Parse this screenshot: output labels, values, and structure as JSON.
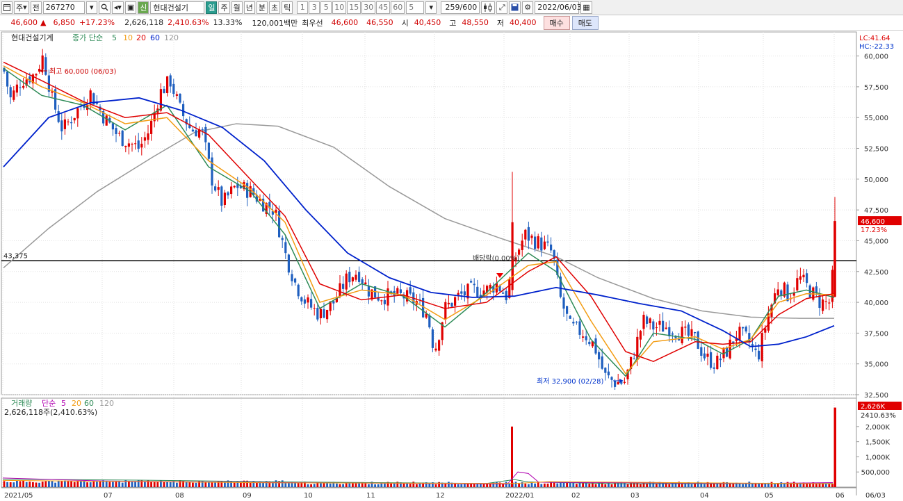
{
  "toolbar": {
    "type_label": "주",
    "prefix_label": "전",
    "code": "267270",
    "badge_label": "신",
    "name": "현대건설기",
    "periods": [
      "일",
      "주",
      "월",
      "년",
      "분",
      "초",
      "틱"
    ],
    "active_period": "일",
    "minute_options": [
      "1",
      "3",
      "5",
      "10",
      "15",
      "30",
      "45",
      "60"
    ],
    "interval_value": "5",
    "count": "259/600",
    "date": "2022/06/03"
  },
  "quote": {
    "price": "46,600",
    "arrow": "▲",
    "change": "6,850",
    "change_pct": "+17.23%",
    "volume": "2,626,118",
    "volume_pct": "2,410.63%",
    "turnover_pct": "13.33%",
    "amount": "120,001백만",
    "best_label": "최우선",
    "ask": "46,600",
    "bid": "46,550",
    "open_label": "시",
    "open": "40,450",
    "high_label": "고",
    "high": "48,550",
    "low_label": "저",
    "low": "40,400",
    "buy_label": "매수",
    "sell_label": "매도"
  },
  "chart": {
    "stock_name": "현대건설기계",
    "ma_type": "종가 단순",
    "ma_periods": [
      "5",
      "10",
      "20",
      "60",
      "120"
    ],
    "lc_label": "LC:41.64",
    "hc_label": "HC:-22.33",
    "hline_label": "43,375",
    "hline_value": 43375,
    "max_label": "최고 60,000 (06/03)",
    "min_label": "최저 32,900 (02/28)",
    "dividend_label": "배당락(0.00%)",
    "current_price": "46,600",
    "current_pct": "17.23%",
    "y_ticks": [
      "60,000",
      "57,500",
      "55,000",
      "52,500",
      "50,000",
      "47,500",
      "45,000",
      "42,500",
      "40,000",
      "37,500",
      "35,000",
      "32,500"
    ],
    "x_ticks": [
      "2021/05",
      "07",
      "08",
      "09",
      "10",
      "11",
      "12",
      "2022/01",
      "02",
      "03",
      "04",
      "05",
      "06",
      "06/03"
    ],
    "colors": {
      "ma5": "#2e8b57",
      "ma10": "#f39c12",
      "ma20": "#e00000",
      "ma60": "#0022cc",
      "ma120": "#999999",
      "up": "#e00000",
      "down": "#1f5fbf"
    }
  },
  "volume": {
    "title": "거래량",
    "ma_type": "단순",
    "ma_periods": [
      "5",
      "20",
      "60",
      "120"
    ],
    "info": "2,626,118주(2,410.63%)",
    "current": "2,626K",
    "current_pct": "2410.63%",
    "y_ticks": [
      "2,000K",
      "1,500K",
      "1,000K",
      "500,000"
    ]
  },
  "chart_data": {
    "type": "candlestick",
    "x_range": [
      "2021/05",
      "2022/06/03"
    ],
    "y_range": [
      32500,
      61500
    ],
    "close_path": [
      [
        5,
        59000
      ],
      [
        15,
        56500
      ],
      [
        30,
        58000
      ],
      [
        50,
        58500
      ],
      [
        62,
        60000
      ],
      [
        75,
        56500
      ],
      [
        90,
        54000
      ],
      [
        110,
        55500
      ],
      [
        130,
        57000
      ],
      [
        150,
        55000
      ],
      [
        170,
        53500
      ],
      [
        185,
        53000
      ],
      [
        200,
        52500
      ],
      [
        215,
        54000
      ],
      [
        230,
        57000
      ],
      [
        245,
        58000
      ],
      [
        260,
        55500
      ],
      [
        275,
        54000
      ],
      [
        290,
        54000
      ],
      [
        305,
        50000
      ],
      [
        320,
        48000
      ],
      [
        340,
        49500
      ],
      [
        360,
        49000
      ],
      [
        380,
        48000
      ],
      [
        395,
        47500
      ],
      [
        410,
        44000
      ],
      [
        425,
        41500
      ],
      [
        440,
        40000
      ],
      [
        460,
        39000
      ],
      [
        480,
        40000
      ],
      [
        500,
        42000
      ],
      [
        515,
        42500
      ],
      [
        530,
        41000
      ],
      [
        545,
        40500
      ],
      [
        560,
        40500
      ],
      [
        580,
        40500
      ],
      [
        600,
        40000
      ],
      [
        615,
        39000
      ],
      [
        625,
        36000
      ],
      [
        640,
        39500
      ],
      [
        660,
        40500
      ],
      [
        680,
        41000
      ],
      [
        700,
        41000
      ],
      [
        715,
        41500
      ],
      [
        728,
        40500
      ],
      [
        740,
        43500
      ],
      [
        755,
        45500
      ],
      [
        770,
        45000
      ],
      [
        785,
        44500
      ],
      [
        795,
        44000
      ],
      [
        805,
        40500
      ],
      [
        820,
        38000
      ],
      [
        840,
        37500
      ],
      [
        855,
        36500
      ],
      [
        870,
        34000
      ],
      [
        885,
        33500
      ],
      [
        898,
        33500
      ],
      [
        910,
        35500
      ],
      [
        925,
        38500
      ],
      [
        940,
        38000
      ],
      [
        960,
        38000
      ],
      [
        980,
        37500
      ],
      [
        1000,
        37000
      ],
      [
        1015,
        35500
      ],
      [
        1030,
        35000
      ],
      [
        1045,
        36000
      ],
      [
        1060,
        37500
      ],
      [
        1075,
        37000
      ],
      [
        1090,
        35500
      ],
      [
        1105,
        39000
      ],
      [
        1120,
        41500
      ],
      [
        1135,
        40500
      ],
      [
        1150,
        42000
      ],
      [
        1165,
        41000
      ],
      [
        1180,
        40000
      ],
      [
        1195,
        40000
      ],
      [
        1203,
        46600
      ]
    ],
    "ma_series": [
      {
        "name": "5",
        "points": [
          [
            5,
            59000
          ],
          [
            60,
            56800
          ],
          [
            120,
            56000
          ],
          [
            180,
            54000
          ],
          [
            240,
            56000
          ],
          [
            300,
            51000
          ],
          [
            360,
            49000
          ],
          [
            410,
            45500
          ],
          [
            460,
            39500
          ],
          [
            520,
            41500
          ],
          [
            580,
            40500
          ],
          [
            640,
            38000
          ],
          [
            700,
            40800
          ],
          [
            760,
            44000
          ],
          [
            800,
            42500
          ],
          [
            850,
            37000
          ],
          [
            900,
            34000
          ],
          [
            940,
            37500
          ],
          [
            1000,
            37000
          ],
          [
            1040,
            35800
          ],
          [
            1080,
            37000
          ],
          [
            1120,
            40500
          ],
          [
            1160,
            41000
          ],
          [
            1200,
            40400
          ]
        ]
      },
      {
        "name": "10",
        "points": [
          [
            5,
            59200
          ],
          [
            60,
            57500
          ],
          [
            120,
            56200
          ],
          [
            180,
            54500
          ],
          [
            240,
            55000
          ],
          [
            300,
            51500
          ],
          [
            360,
            49200
          ],
          [
            410,
            46500
          ],
          [
            460,
            40000
          ],
          [
            520,
            41000
          ],
          [
            580,
            40600
          ],
          [
            640,
            38600
          ],
          [
            700,
            40600
          ],
          [
            760,
            43000
          ],
          [
            800,
            43300
          ],
          [
            850,
            38500
          ],
          [
            900,
            34200
          ],
          [
            940,
            36800
          ],
          [
            1000,
            37200
          ],
          [
            1040,
            36200
          ],
          [
            1080,
            37000
          ],
          [
            1120,
            40000
          ],
          [
            1160,
            40700
          ],
          [
            1200,
            40600
          ]
        ]
      },
      {
        "name": "20",
        "points": [
          [
            5,
            59500
          ],
          [
            60,
            58000
          ],
          [
            120,
            56300
          ],
          [
            180,
            55000
          ],
          [
            240,
            55400
          ],
          [
            300,
            53600
          ],
          [
            360,
            50000
          ],
          [
            410,
            47000
          ],
          [
            460,
            41500
          ],
          [
            520,
            40200
          ],
          [
            580,
            40600
          ],
          [
            640,
            39500
          ],
          [
            700,
            40000
          ],
          [
            760,
            42500
          ],
          [
            800,
            43700
          ],
          [
            850,
            40500
          ],
          [
            900,
            36000
          ],
          [
            940,
            35200
          ],
          [
            1000,
            36800
          ],
          [
            1040,
            36600
          ],
          [
            1080,
            36800
          ],
          [
            1120,
            39000
          ],
          [
            1160,
            40300
          ],
          [
            1200,
            40700
          ]
        ]
      },
      {
        "name": "60",
        "points": [
          [
            5,
            51000
          ],
          [
            70,
            55000
          ],
          [
            130,
            56200
          ],
          [
            200,
            56600
          ],
          [
            260,
            55600
          ],
          [
            320,
            54200
          ],
          [
            380,
            51500
          ],
          [
            440,
            47500
          ],
          [
            500,
            44000
          ],
          [
            560,
            42000
          ],
          [
            620,
            40800
          ],
          [
            680,
            40400
          ],
          [
            740,
            40500
          ],
          [
            800,
            41200
          ],
          [
            860,
            40600
          ],
          [
            920,
            39900
          ],
          [
            980,
            39300
          ],
          [
            1040,
            37700
          ],
          [
            1080,
            36400
          ],
          [
            1120,
            36600
          ],
          [
            1160,
            37200
          ],
          [
            1200,
            38100
          ]
        ]
      },
      {
        "name": "120",
        "points": [
          [
            5,
            42800
          ],
          [
            70,
            46000
          ],
          [
            140,
            49000
          ],
          [
            220,
            51800
          ],
          [
            280,
            53800
          ],
          [
            340,
            54500
          ],
          [
            400,
            54300
          ],
          [
            480,
            52600
          ],
          [
            560,
            49400
          ],
          [
            640,
            46800
          ],
          [
            720,
            45200
          ],
          [
            800,
            43700
          ],
          [
            860,
            42000
          ],
          [
            940,
            40300
          ],
          [
            1010,
            39300
          ],
          [
            1080,
            38800
          ],
          [
            1150,
            38700
          ],
          [
            1200,
            38700
          ]
        ]
      }
    ],
    "volume_bars": [
      {
        "x": "2022/01",
        "value": 2000000
      },
      {
        "x": "2022/06/03",
        "value": 2626118
      }
    ]
  }
}
